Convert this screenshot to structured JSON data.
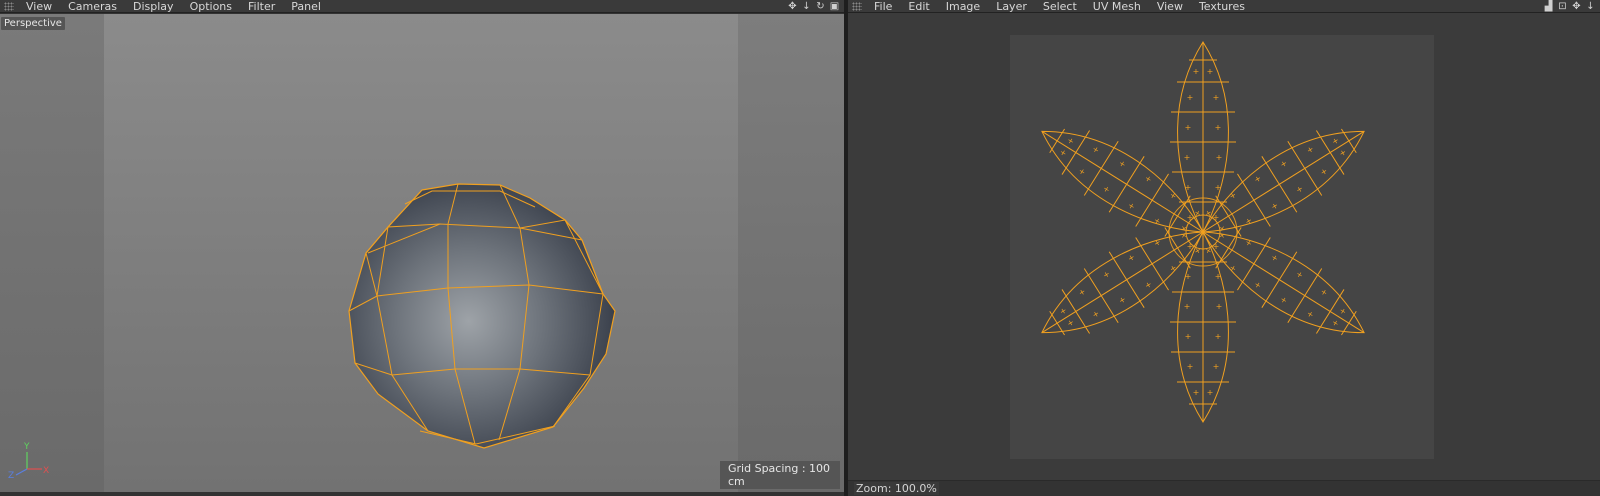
{
  "viewport_panel": {
    "menu": [
      "View",
      "Cameras",
      "Display",
      "Options",
      "Filter",
      "Panel"
    ],
    "camera_label": "Perspective",
    "grid_spacing": "Grid Spacing : 100 cm",
    "axis_labels": {
      "y": "Y",
      "x": "X",
      "z": "Z"
    },
    "tool_icons": [
      "move-view-icon",
      "dolly-view-icon",
      "rotate-view-icon",
      "toggle-view-icon"
    ]
  },
  "uv_panel": {
    "menu": [
      "File",
      "Edit",
      "Image",
      "Layer",
      "Select",
      "UV Mesh",
      "View",
      "Textures"
    ],
    "status": "Zoom: 100.0%",
    "tool_icons": [
      "histogram-icon",
      "lock-icon",
      "move-view-icon",
      "dolly-view-icon"
    ]
  },
  "colors": {
    "wire": "#f0a020",
    "uv_background": "#454545",
    "panel_dark": "#3b3b3b"
  }
}
